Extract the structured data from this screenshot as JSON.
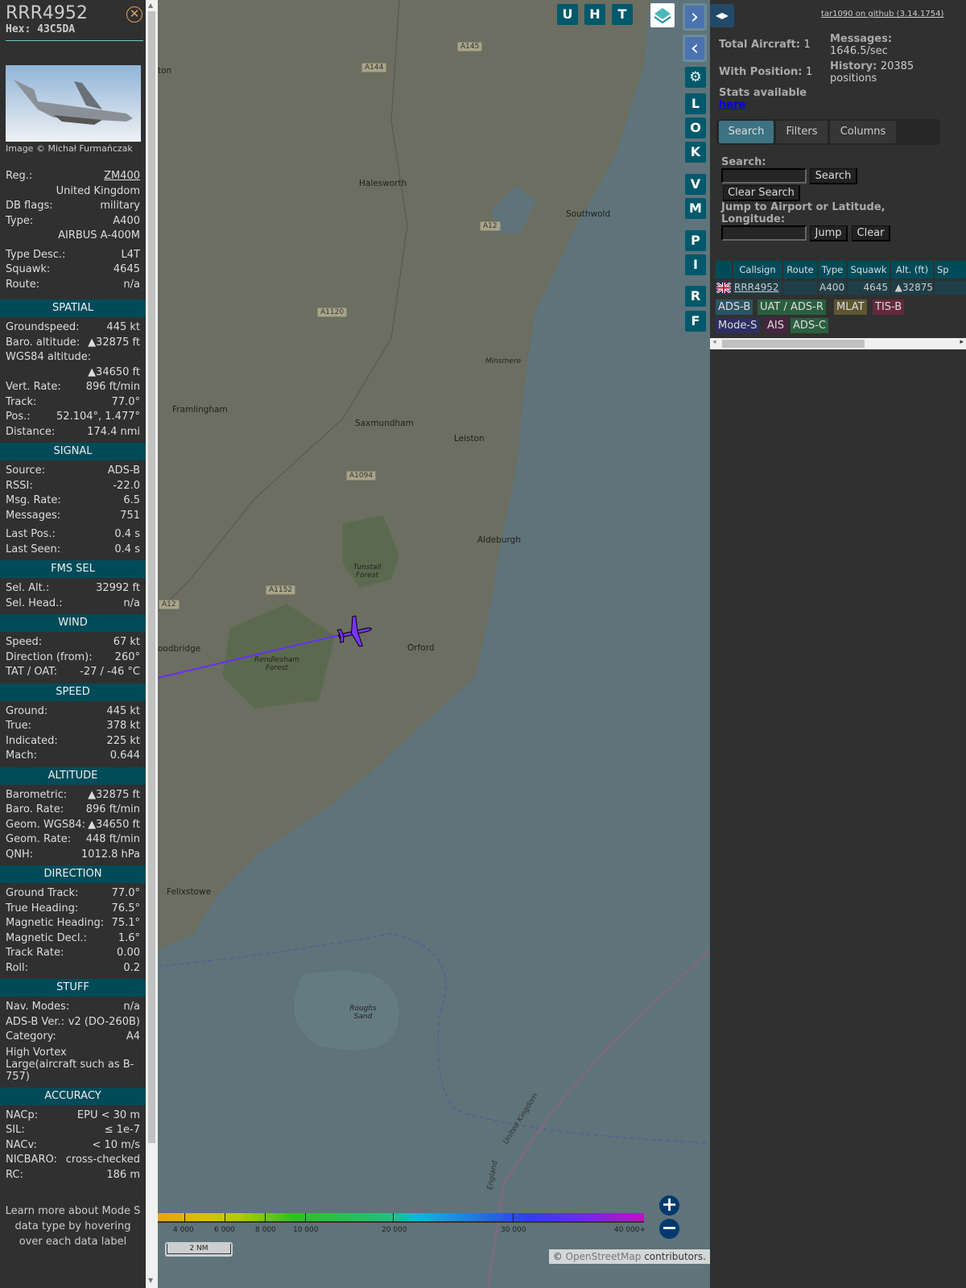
{
  "aircraft": {
    "callsign": "RRR4952",
    "hex_label": "Hex: 43C5DA",
    "image_credit": "Image © Michał Furmańczak"
  },
  "info": [
    {
      "label": "Reg.:",
      "value": "ZM400",
      "link": true
    },
    {
      "label": "",
      "value": "United Kingdom"
    },
    {
      "label": "DB flags:",
      "value": "military"
    },
    {
      "label": "Type:",
      "value": "A400"
    },
    {
      "label": "",
      "value": "AIRBUS A-400M"
    },
    {
      "gap": true
    },
    {
      "label": "Type Desc.:",
      "value": "L4T"
    },
    {
      "label": "Squawk:",
      "value": "4645"
    },
    {
      "label": "Route:",
      "value": "n/a"
    }
  ],
  "sections": [
    {
      "title": "SPATIAL",
      "rows": [
        {
          "label": "Groundspeed:",
          "value": "445 kt"
        },
        {
          "label": "Baro. altitude:",
          "value": "▲32875 ft"
        },
        {
          "label": "WGS84 altitude:",
          "value": ""
        },
        {
          "label": "",
          "value": "▲34650 ft"
        },
        {
          "label": "Vert. Rate:",
          "value": "896 ft/min"
        },
        {
          "label": "Track:",
          "value": "77.0°"
        },
        {
          "label": "Pos.:",
          "value": "52.104°, 1.477°"
        },
        {
          "label": "Distance:",
          "value": "174.4 nmi"
        }
      ]
    },
    {
      "title": "SIGNAL",
      "rows": [
        {
          "label": "Source:",
          "value": "ADS-B"
        },
        {
          "label": "RSSI:",
          "value": "-22.0"
        },
        {
          "label": "Msg. Rate:",
          "value": "6.5"
        },
        {
          "label": "Messages:",
          "value": "751"
        },
        {
          "label": "Last Pos.:",
          "value": "0.4 s"
        },
        {
          "label": "Last Seen:",
          "value": "0.4 s"
        }
      ]
    },
    {
      "title": "FMS SEL",
      "rows": [
        {
          "label": "Sel. Alt.:",
          "value": "32992 ft"
        },
        {
          "label": "Sel. Head.:",
          "value": "n/a"
        }
      ]
    },
    {
      "title": "WIND",
      "rows": [
        {
          "label": "Speed:",
          "value": "67 kt"
        },
        {
          "label": "Direction (from):",
          "value": "260°"
        },
        {
          "label": "TAT / OAT:",
          "value": "-27 / -46 °C"
        }
      ]
    },
    {
      "title": "SPEED",
      "rows": [
        {
          "label": "Ground:",
          "value": "445 kt"
        },
        {
          "label": "True:",
          "value": "378 kt"
        },
        {
          "label": "Indicated:",
          "value": "225 kt"
        },
        {
          "label": "Mach:",
          "value": "0.644"
        }
      ]
    },
    {
      "title": "ALTITUDE",
      "rows": [
        {
          "label": "Barometric:",
          "value": "▲32875 ft"
        },
        {
          "label": "Baro. Rate:",
          "value": "896 ft/min"
        },
        {
          "label": "Geom. WGS84:",
          "value": "▲34650 ft"
        },
        {
          "label": "Geom. Rate:",
          "value": "448 ft/min"
        },
        {
          "label": "QNH:",
          "value": "1012.8 hPa"
        }
      ]
    },
    {
      "title": "DIRECTION",
      "rows": [
        {
          "label": "Ground Track:",
          "value": "77.0°"
        },
        {
          "label": "True Heading:",
          "value": "76.5°"
        },
        {
          "label": "Magnetic Heading:",
          "value": "75.1°"
        },
        {
          "label": "Magnetic Decl.:",
          "value": "1.6°"
        },
        {
          "label": "Track Rate:",
          "value": "0.00"
        },
        {
          "label": "Roll:",
          "value": "0.2"
        }
      ]
    },
    {
      "title": "STUFF",
      "rows": [
        {
          "label": "Nav. Modes:",
          "value": "n/a"
        },
        {
          "label": "ADS-B Ver.:",
          "value": "v2 (DO-260B)"
        },
        {
          "label": "Category:",
          "value": "A4"
        },
        {
          "label": "High Vortex Large(aircraft such as B-757)",
          "value": "",
          "wrap": true
        }
      ]
    },
    {
      "title": "ACCURACY",
      "rows": [
        {
          "label": "NACp:",
          "value": "EPU < 30 m"
        },
        {
          "label": "SIL:",
          "value": "≤ 1e-7"
        },
        {
          "label": "NACv:",
          "value": "< 10 m/s"
        },
        {
          "label": "NICBARO:",
          "value": "cross-checked"
        },
        {
          "label": "RC:",
          "value": "186 m"
        }
      ]
    }
  ],
  "footer_note": "Learn more about Mode S data type by hovering over each data label",
  "map": {
    "top_buttons": [
      "U",
      "H",
      "T"
    ],
    "side_buttons": [
      "L",
      "O",
      "K",
      "V",
      "M",
      "P",
      "I",
      "R",
      "F"
    ],
    "places": [
      {
        "name": "Halesworth"
      },
      {
        "name": "Southwold"
      },
      {
        "name": "Framlingham"
      },
      {
        "name": "Saxmundham"
      },
      {
        "name": "Leiston"
      },
      {
        "name": "Aldeburgh"
      },
      {
        "name": "Orford"
      },
      {
        "name": "oodbridge"
      },
      {
        "name": "Felixstowe"
      },
      {
        "name": "Minsmere"
      },
      {
        "name": "Tunstall Forest"
      },
      {
        "name": "Rendlesham Forest"
      },
      {
        "name": "Roughs Sand"
      },
      {
        "name": "United Kingdom"
      },
      {
        "name": "England"
      },
      {
        "name": "ton"
      }
    ],
    "roads": [
      "A145",
      "A144",
      "A12",
      "A1120",
      "A1094",
      "A1152",
      "A12"
    ],
    "altitude_scale": [
      "4 000",
      "6 000",
      "8 000",
      "10 000",
      "20 000",
      "30 000",
      "40 000+"
    ],
    "scale_bar": "2 NM",
    "attribution_prefix": "© ",
    "attribution_link": "OpenStreetMap",
    "attribution_suffix": " contributors.",
    "track_color": "#6a2cff"
  },
  "right": {
    "github_link": "tar1090 on github (3.14.1754)",
    "total_aircraft_label": "Total Aircraft:",
    "total_aircraft": "1",
    "with_position_label": "With Position:",
    "with_position": "1",
    "messages_label": "Messages:",
    "messages": "1646.5/sec",
    "history_label": "History:",
    "history": "20385 positions",
    "stats_text": "Stats available",
    "stats_link": "here",
    "tabs": [
      "Search",
      "Filters",
      "Columns"
    ],
    "search_label": "Search:",
    "search_button": "Search",
    "clear_search_button": "Clear Search",
    "jump_label": "Jump to Airport or Latitude, Longitude:",
    "jump_button": "Jump",
    "clear_button": "Clear",
    "table": {
      "headers": [
        "",
        "Callsign",
        "Route",
        "Type",
        "Squawk",
        "Alt. (ft)",
        "Sp"
      ],
      "rows": [
        {
          "flag": "uk-flag",
          "callsign": "RRR4952",
          "route": "",
          "type": "A400",
          "squawk": "4645",
          "alt": "▲32875"
        }
      ]
    },
    "legend": [
      {
        "label": "ADS-B",
        "color": "#2c5364"
      },
      {
        "label": "UAT / ADS-R",
        "color": "#2a5e3e"
      },
      {
        "label": "MLAT",
        "color": "#5e5632"
      },
      {
        "label": "TIS-B",
        "color": "#64283e"
      },
      {
        "label": "Mode-S",
        "color": "#2c2e64"
      },
      {
        "label": "AIS",
        "color": "#4a2440"
      },
      {
        "label": "ADS-C",
        "color": "#2a6040"
      }
    ]
  }
}
